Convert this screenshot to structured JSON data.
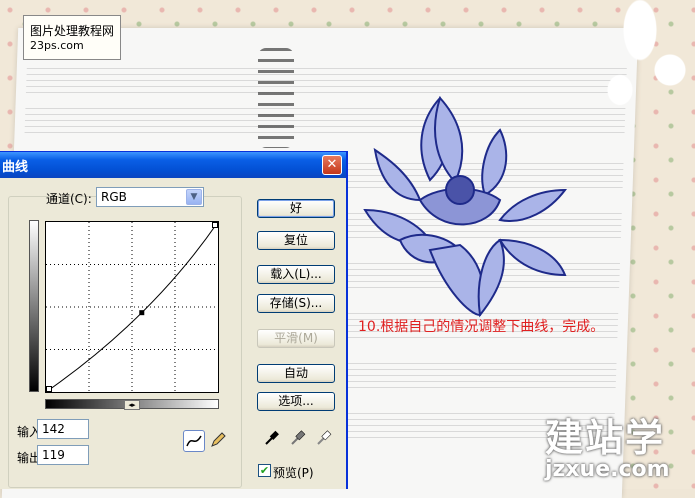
{
  "background": {
    "logo": {
      "line1": "图片处理教程网",
      "line2": "23ps.com"
    },
    "caption": "10.根据自己的情况调整下曲线，完成。",
    "watermark": {
      "line1": "建站学",
      "line2": "jzxue.com"
    }
  },
  "dialog": {
    "title": "曲线",
    "close_icon": "close-icon",
    "channel": {
      "label": "通道(C):",
      "value": "RGB"
    },
    "input": {
      "label": "输入:",
      "value": "142"
    },
    "output": {
      "label": "输出:",
      "value": "119"
    },
    "curve": {
      "point_input": 142,
      "point_output": 119,
      "max": 255
    },
    "buttons": {
      "ok": "好",
      "reset": "复位",
      "load": "载入(L)...",
      "save": "存储(S)...",
      "smooth": "平滑(M)",
      "auto": "自动",
      "options": "选项..."
    },
    "preview": {
      "label": "预览(P)",
      "checked": true
    },
    "icons": [
      "curve-tool-icon",
      "pencil-icon",
      "black-eyedropper-icon",
      "gray-eyedropper-icon",
      "white-eyedropper-icon"
    ]
  }
}
